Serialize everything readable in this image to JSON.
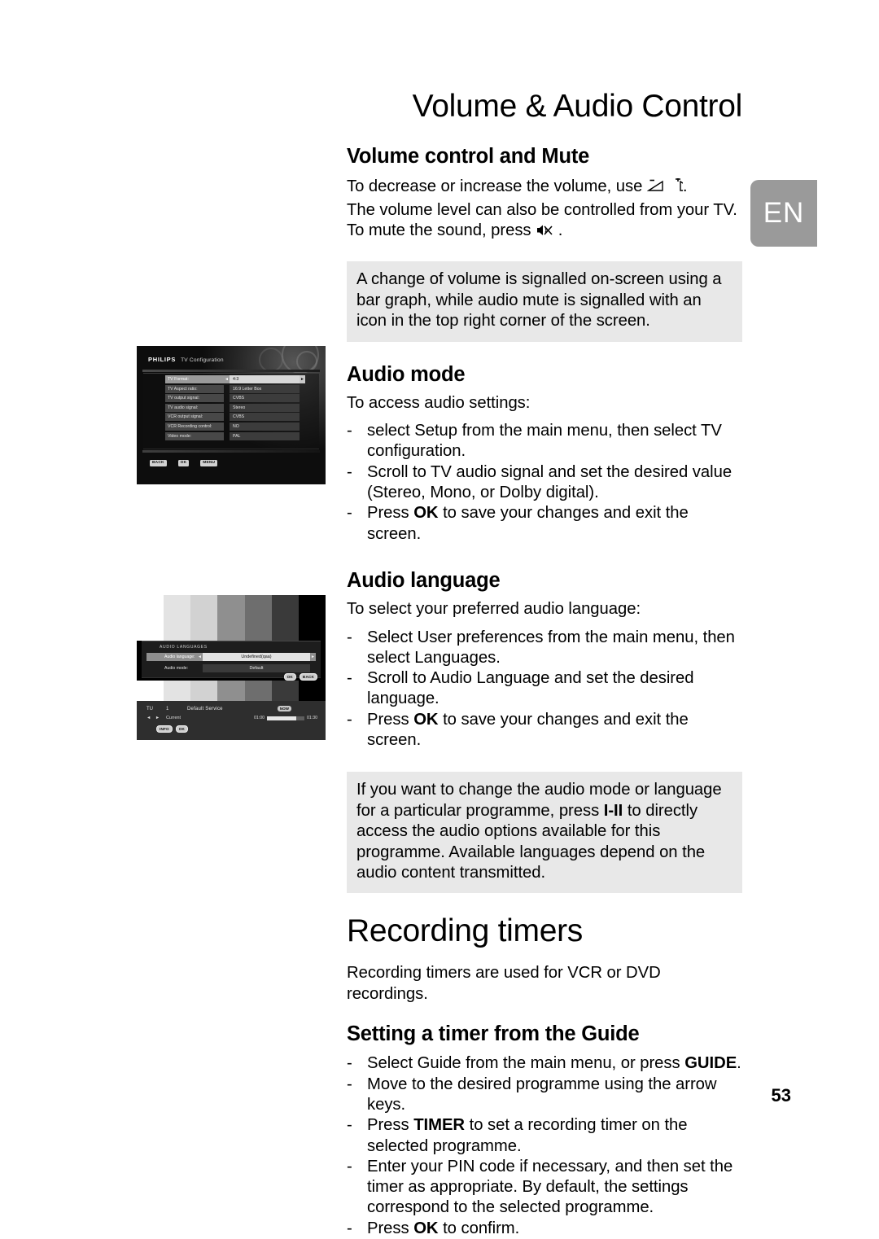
{
  "page": {
    "language_tab": "EN",
    "page_number": "53"
  },
  "chapter1": {
    "title": "Volume & Audio Control",
    "sections": [
      {
        "heading": "Volume control and Mute",
        "lines": [
          "To decrease or increase the volume, use ",
          "The volume level can also be controlled from your TV.",
          "To mute the sound, press "
        ],
        "line1_suffix": ".",
        "line3_suffix": " ."
      }
    ],
    "note1": "A change of volume is signalled on-screen using a bar graph, while audio mute is signalled with an icon in the top right corner of the screen.",
    "audio_mode": {
      "heading": "Audio mode",
      "intro": "To access audio settings:",
      "bullets": [
        "select Setup from the main menu, then select TV configuration.",
        "Scroll to TV audio signal and set the desired value (Stereo, Mono, or Dolby digital).",
        "Press OK to save your changes and exit the screen."
      ]
    },
    "audio_language": {
      "heading": "Audio language",
      "intro": "To select your preferred audio language:",
      "bullets": [
        "Select User preferences from the main menu, then select Languages.",
        "Scroll to Audio Language and set the desired language.",
        "Press OK to save your changes and exit the screen."
      ]
    },
    "note2": "If you want to change the audio mode or language for a particular programme, press I-II to directly access the audio options available for this programme. Available languages depend on the audio content transmitted."
  },
  "chapter2": {
    "title": "Recording timers",
    "intro": "Recording timers are used for VCR or DVD recordings.",
    "section": {
      "heading": "Setting a timer from the Guide",
      "bullets": [
        "Select Guide from the main menu, or press GUIDE.",
        "Move to the desired programme using the arrow keys.",
        "Press TIMER to set a recording timer on the selected programme.",
        "Enter your PIN code if necessary, and then set the timer as appropriate. By default, the settings correspond to the selected programme.",
        "Press OK to confirm."
      ]
    }
  },
  "tv_config_screen": {
    "brand": "PHILIPS",
    "title": "TV Configuration",
    "rows": [
      {
        "label": "TV Format:",
        "value": "4:3",
        "selected": true
      },
      {
        "label": "TV Aspect ratio:",
        "value": "16:9 Letter Box",
        "selected": false
      },
      {
        "label": "TV output signal:",
        "value": "CVBS",
        "selected": false
      },
      {
        "label": "TV audio signal:",
        "value": "Stereo",
        "selected": false
      },
      {
        "label": "VCR output signal:",
        "value": "CVBS",
        "selected": false
      },
      {
        "label": "VCR Recording control:",
        "value": "NO",
        "selected": false
      },
      {
        "label": "Video mode:",
        "value": "PAL",
        "selected": false
      }
    ],
    "arrow_left": "◄",
    "arrow_right": "►",
    "buttons": [
      "BACK",
      "OK",
      "MENU"
    ]
  },
  "tv_audio_screen": {
    "panel_title": "AUDIO LANGUAGES",
    "rows": [
      {
        "label": "Audio language:",
        "value": "Undefined(qaa)",
        "selected": true
      },
      {
        "label": "Audio mode:",
        "value": "Default",
        "selected": false
      }
    ],
    "arrow_left": "◄",
    "arrow_right": "►",
    "panel_keys": [
      "OK",
      "BACK"
    ],
    "banner": {
      "tuner": "TU",
      "number": "1",
      "service": "Default Service",
      "badge": "NOW",
      "nav": "◄ ►",
      "state": "Current",
      "start_time": "01:00",
      "end_time": "01:30",
      "keys": [
        "INFO",
        "OK"
      ]
    }
  }
}
